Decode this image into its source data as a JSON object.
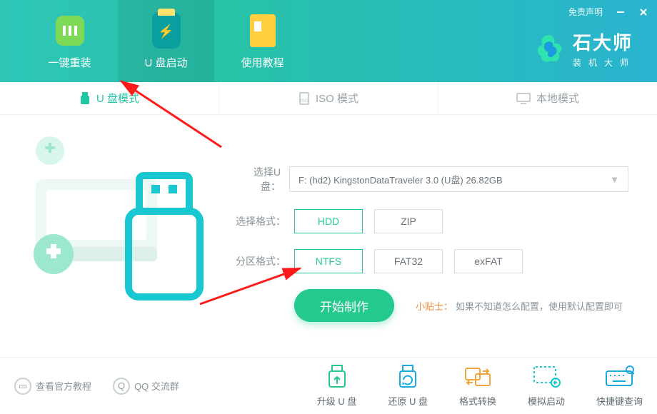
{
  "titlebar": {
    "disclaimer": "免责声明",
    "logo_big": "石大师",
    "logo_small": "装机大师"
  },
  "top_tabs": [
    {
      "label": "一键重装"
    },
    {
      "label": "U 盘启动"
    },
    {
      "label": "使用教程"
    }
  ],
  "sub_tabs": [
    {
      "label": "U 盘模式"
    },
    {
      "label": "ISO 模式"
    },
    {
      "label": "本地模式"
    }
  ],
  "form": {
    "select_label": "选择U盘：",
    "select_value": "F: (hd2) KingstonDataTraveler 3.0 (U盘) 26.82GB",
    "format_label": "选择格式：",
    "format_options": [
      "HDD",
      "ZIP"
    ],
    "format_selected": "HDD",
    "partition_label": "分区格式：",
    "partition_options": [
      "NTFS",
      "FAT32",
      "exFAT"
    ],
    "partition_selected": "NTFS",
    "primary_button": "开始制作",
    "tip_label": "小贴士：",
    "tip_text": "如果不知道怎么配置，使用默认配置即可"
  },
  "footer": {
    "left_links": [
      "查看官方教程",
      "QQ 交流群"
    ],
    "tools": [
      "升级 U 盘",
      "还原 U 盘",
      "格式转换",
      "模拟启动",
      "快捷键查询"
    ]
  }
}
